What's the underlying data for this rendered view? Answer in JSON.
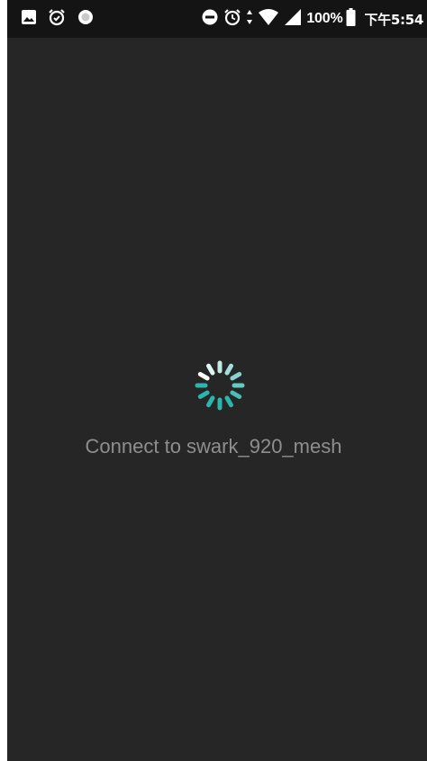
{
  "status_bar": {
    "battery_percent": "100%",
    "time": "下午5:54",
    "icons": [
      "image-icon",
      "alarm-check-icon",
      "record-dot-icon",
      "do-not-disturb-icon",
      "alarm-icon",
      "data-arrows-icon",
      "wifi-icon",
      "cell-signal-icon",
      "battery-icon"
    ]
  },
  "dialog": {
    "message": "Connect to swark_920_mesh"
  },
  "spinner": {
    "icon": "loading-spinner-icon",
    "colors": [
      "#2bb6ad",
      "#ffffff"
    ]
  },
  "colors": {
    "background": "#262626",
    "status_bar": "#141414",
    "message_text": "#8e8e8e"
  }
}
